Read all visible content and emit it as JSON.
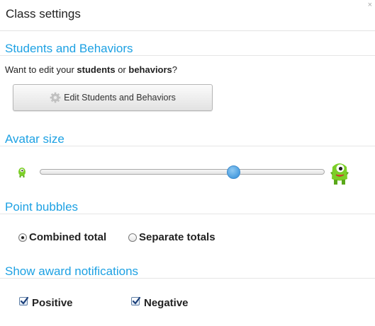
{
  "dialog": {
    "title": "Class settings",
    "close_glyph": "×"
  },
  "students_section": {
    "heading": "Students and Behaviors",
    "prompt_prefix": "Want to edit your ",
    "prompt_bold_1": "students",
    "prompt_middle": " or ",
    "prompt_bold_2": "behaviors",
    "prompt_suffix": "?",
    "button_label": "Edit Students and Behaviors",
    "button_icon": "gear-icon"
  },
  "avatar_section": {
    "heading": "Avatar size",
    "slider_value": 0.69,
    "min_icon": "small-monster-icon",
    "max_icon": "large-monster-icon"
  },
  "bubbles_section": {
    "heading": "Point bubbles",
    "options": [
      {
        "label": "Combined total",
        "selected": true
      },
      {
        "label": "Separate totals",
        "selected": false
      }
    ]
  },
  "notifications_section": {
    "heading": "Show award notifications",
    "options": [
      {
        "label": "Positive",
        "checked": true
      },
      {
        "label": "Negative",
        "checked": true
      }
    ]
  },
  "colors": {
    "heading_blue": "#1da1e3",
    "slider_thumb": "#4a9ee0",
    "monster_green": "#7ccf28"
  }
}
